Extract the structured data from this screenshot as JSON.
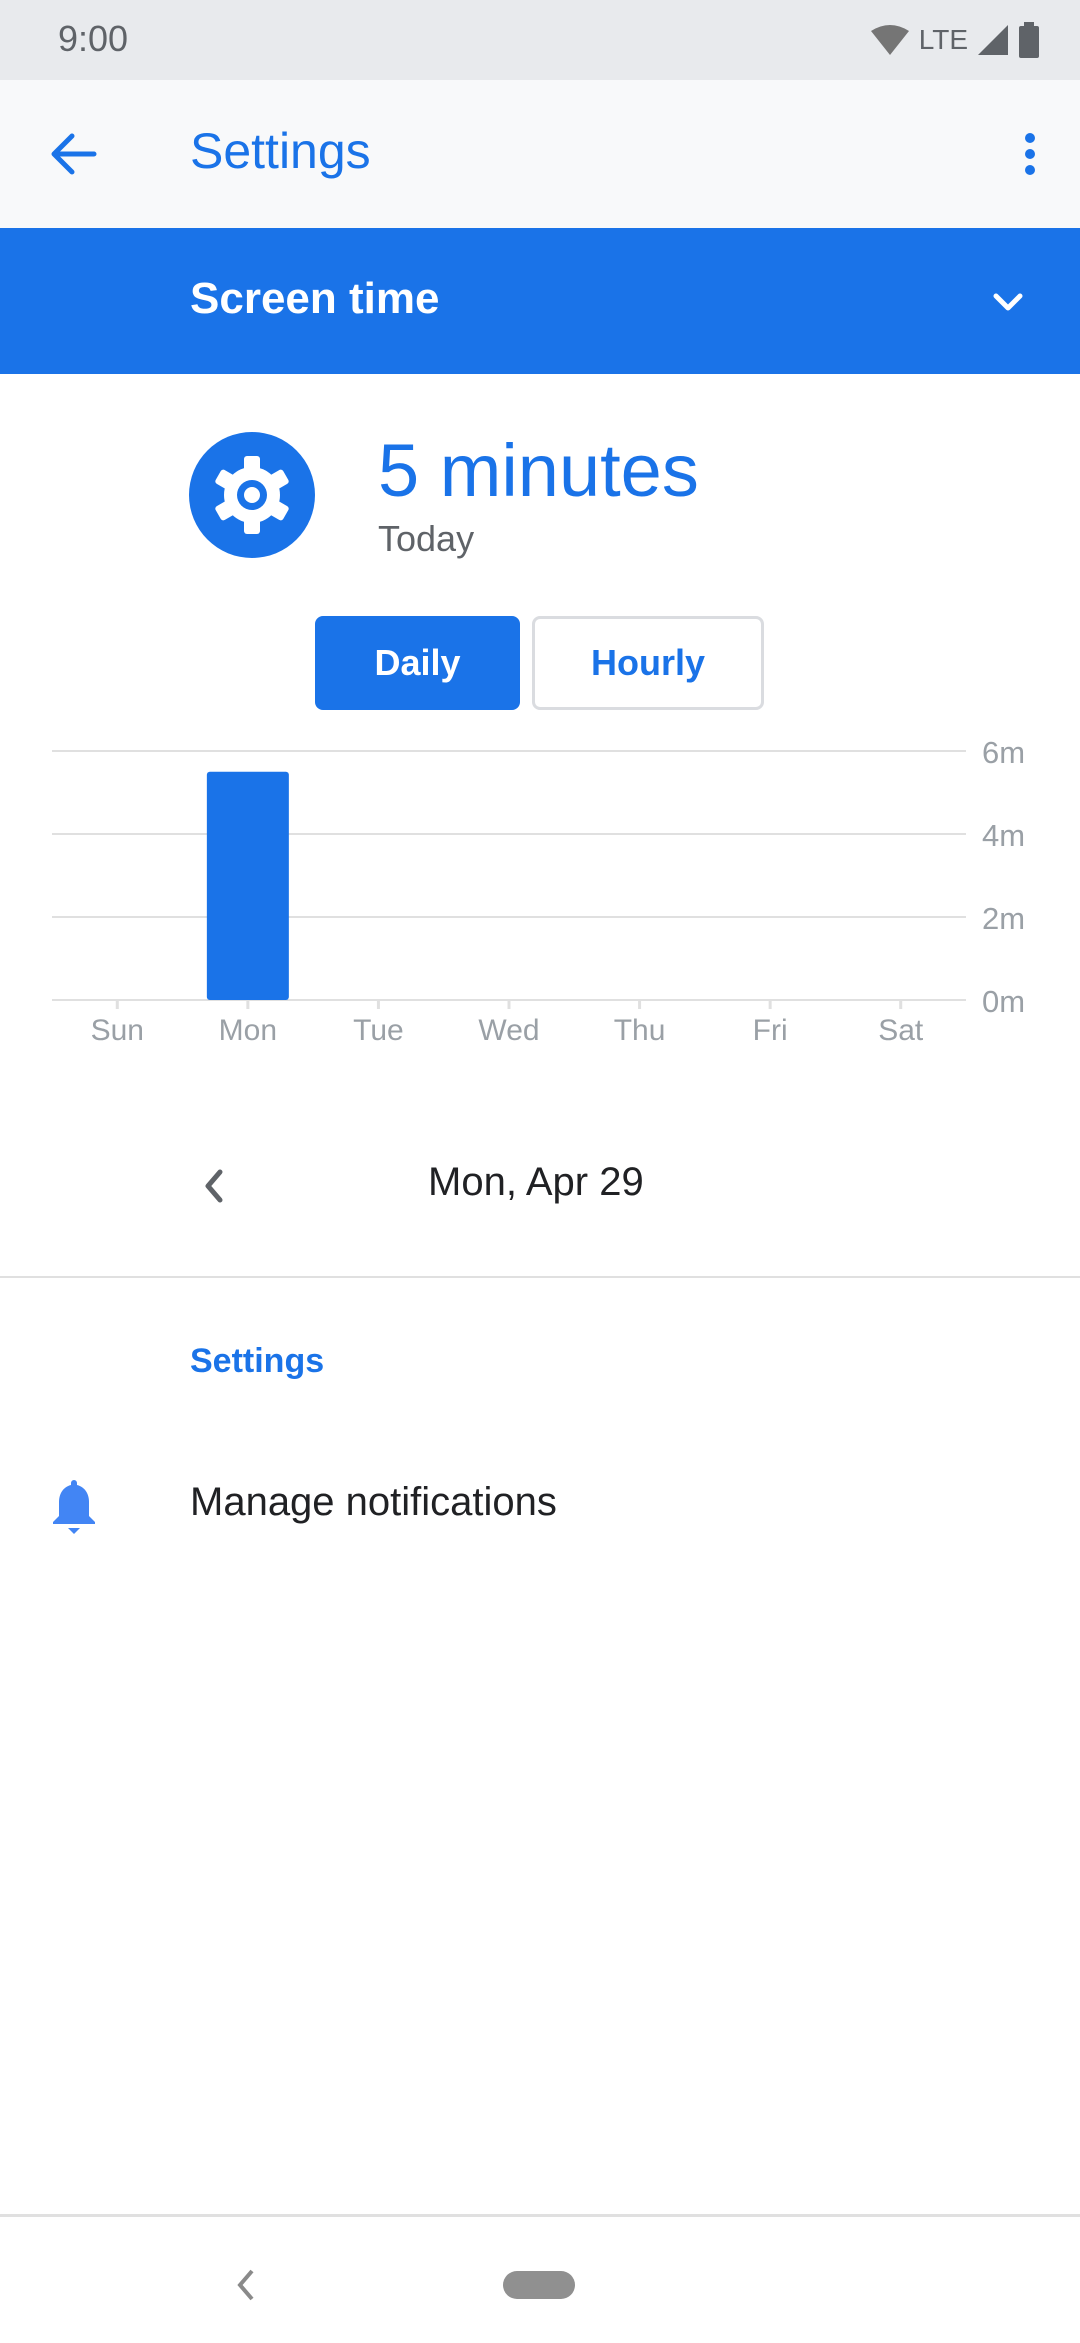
{
  "status_bar": {
    "time": "9:00",
    "network": "LTE",
    "icons": [
      "wifi-icon",
      "signal-icon",
      "battery-icon"
    ]
  },
  "app_bar": {
    "title": "Settings",
    "back_icon": "arrow-back-icon",
    "menu_icon": "more-vert-icon"
  },
  "section": {
    "title": "Screen time",
    "expand_icon": "chevron-down-icon"
  },
  "summary": {
    "app_icon": "settings-gear-icon",
    "value": "5 minutes",
    "label": "Today"
  },
  "view_toggle": {
    "options": [
      {
        "label": "Daily",
        "selected": true
      },
      {
        "label": "Hourly",
        "selected": false
      }
    ]
  },
  "date_nav": {
    "prev_icon": "chevron-left-icon",
    "label": "Mon, Apr 29"
  },
  "settings_section": {
    "header": "Settings",
    "items": [
      {
        "icon": "bell-icon",
        "label": "Manage notifications"
      }
    ]
  },
  "nav_bar": {
    "back_icon": "nav-back-icon",
    "home_icon": "home-pill-icon"
  },
  "colors": {
    "accent": "#1a73e8",
    "status_bar_bg": "#e8eaed",
    "app_bar_bg": "#f8f9fa",
    "grid": "#e0e0e0",
    "axis_text": "#9aa0a6"
  },
  "chart_data": {
    "type": "bar",
    "title": "",
    "xlabel": "",
    "ylabel": "",
    "categories": [
      "Sun",
      "Mon",
      "Tue",
      "Wed",
      "Thu",
      "Fri",
      "Sat"
    ],
    "values": [
      0,
      5.5,
      0,
      0,
      0,
      0,
      0
    ],
    "unit": "minutes",
    "ylim": [
      0,
      6
    ],
    "yticks": [
      0,
      2,
      4,
      6
    ],
    "ytick_labels": [
      "0m",
      "2m",
      "4m",
      "6m"
    ],
    "grid": true,
    "y_axis_position": "right",
    "legend": "none"
  }
}
